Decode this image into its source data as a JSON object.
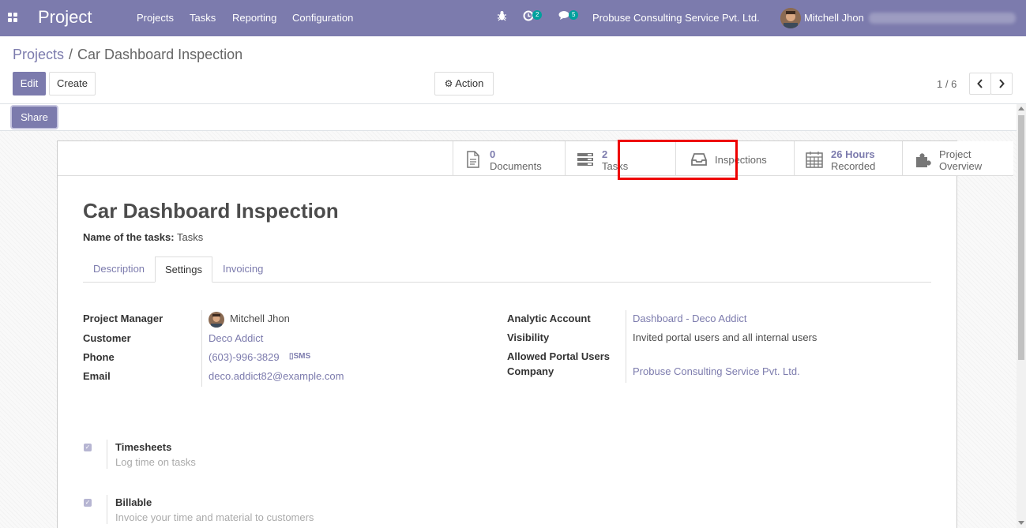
{
  "navbar": {
    "brand": "Project",
    "menu": [
      "Projects",
      "Tasks",
      "Reporting",
      "Configuration"
    ],
    "activity_badge": "2",
    "messages_badge": "5",
    "company": "Probuse Consulting Service Pvt. Ltd.",
    "user": "Mitchell Jhon",
    "color": "#7c7bad"
  },
  "breadcrumb": {
    "parent": "Projects",
    "separator": "/",
    "current": "Car Dashboard Inspection"
  },
  "toolbar": {
    "edit_label": "Edit",
    "create_label": "Create",
    "action_label": "Action",
    "share_label": "Share",
    "pager": "1 / 6"
  },
  "smart_buttons": [
    {
      "value": "0",
      "label": "Documents",
      "icon": "document-icon"
    },
    {
      "value": "2",
      "label": "Tasks",
      "icon": "tasks-icon"
    },
    {
      "value": "",
      "label": "Inspections",
      "icon": "inbox-icon",
      "highlighted": true
    },
    {
      "value": "26 Hours",
      "label": "Recorded",
      "icon": "calendar-icon"
    },
    {
      "value": "",
      "label": "Project",
      "label2": "Overview",
      "icon": "puzzle-icon"
    }
  ],
  "record": {
    "title": "Car Dashboard Inspection",
    "name_of_tasks_label": "Name of the tasks:",
    "name_of_tasks_value": "Tasks"
  },
  "tabs": [
    "Description",
    "Settings",
    "Invoicing"
  ],
  "active_tab": "Settings",
  "fields_left": {
    "manager_label": "Project Manager",
    "manager_value": "Mitchell Jhon",
    "customer_label": "Customer",
    "customer_value": "Deco Addict",
    "phone_label": "Phone",
    "phone_value": "(603)-996-3829",
    "sms_label": "SMS",
    "email_label": "Email",
    "email_value": "deco.addict82@example.com"
  },
  "fields_right": {
    "analytic_label": "Analytic Account",
    "analytic_value": "Dashboard - Deco Addict",
    "visibility_label": "Visibility",
    "visibility_value": "Invited portal users and all internal users",
    "portal_label": "Allowed Portal Users",
    "company_label": "Company",
    "company_value": "Probuse Consulting Service Pvt. Ltd."
  },
  "options": [
    {
      "title": "Timesheets",
      "desc": "Log time on tasks",
      "checked": true
    },
    {
      "title": "Billable",
      "desc": "Invoice your time and material to customers",
      "checked": true
    }
  ]
}
